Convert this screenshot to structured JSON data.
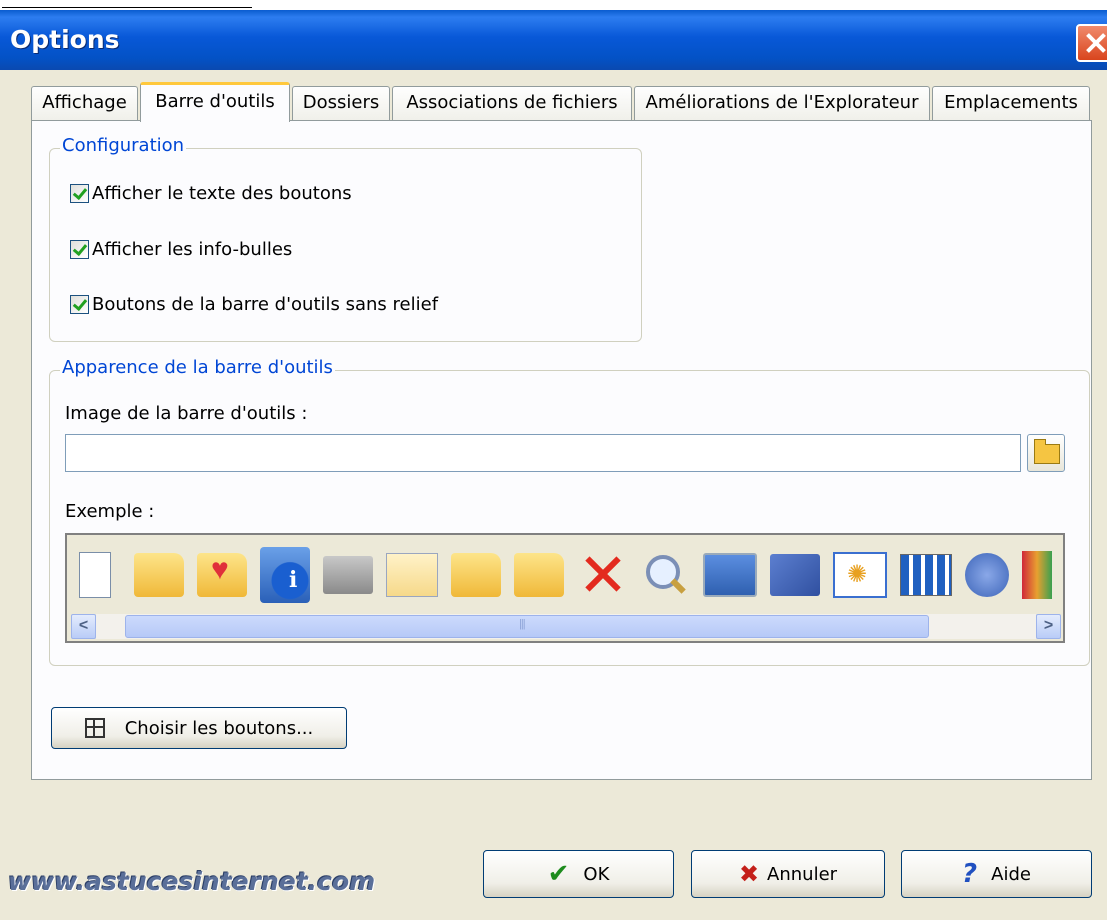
{
  "window": {
    "title": "Options"
  },
  "tabs": [
    {
      "label": "Affichage"
    },
    {
      "label": "Barre d'outils"
    },
    {
      "label": "Dossiers"
    },
    {
      "label": "Associations de fichiers"
    },
    {
      "label": "Améliorations de l'Explorateur"
    },
    {
      "label": "Emplacements"
    }
  ],
  "active_tab": "Barre d'outils",
  "configuration": {
    "legend": "Configuration",
    "options": [
      {
        "label": "Afficher le texte des boutons",
        "checked": true
      },
      {
        "label": "Afficher les info-bulles",
        "checked": true
      },
      {
        "label": "Boutons de la barre d'outils sans relief",
        "checked": true
      }
    ]
  },
  "appearance": {
    "legend": "Apparence de la barre d'outils",
    "image_label": "Image de la barre d'outils :",
    "image_value": "",
    "example_label": "Exemple :",
    "example_icons": [
      "new-document-icon",
      "open-folder-icon",
      "favorites-folder-icon",
      "properties-info-icon",
      "print-icon",
      "mail-icon",
      "move-to-icon",
      "copy-to-icon",
      "delete-icon",
      "search-icon",
      "control-panel-icon",
      "tools-icon",
      "settings-icon",
      "folder-options-icon",
      "network-icon",
      "books-icon"
    ]
  },
  "choose_buttons_label": "Choisir les boutons...",
  "footer": {
    "watermark": "www.astucesinternet.com",
    "ok_label": "OK",
    "cancel_label": "Annuler",
    "help_label": "Aide"
  }
}
